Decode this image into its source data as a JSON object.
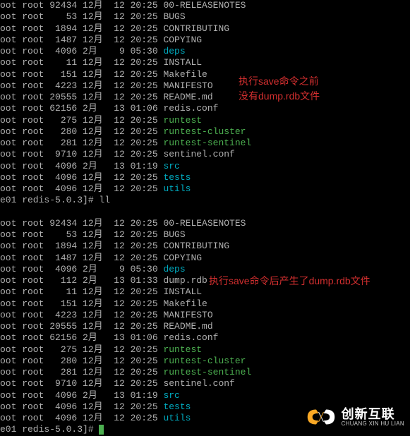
{
  "listing1": [
    {
      "perm": "oot root 92434 12月  12 20:25",
      "name": "00-RELEASENOTES",
      "color": "gray"
    },
    {
      "perm": "oot root    53 12月  12 20:25",
      "name": "BUGS",
      "color": "gray"
    },
    {
      "perm": "oot root  1894 12月  12 20:25",
      "name": "CONTRIBUTING",
      "color": "gray"
    },
    {
      "perm": "oot root  1487 12月  12 20:25",
      "name": "COPYING",
      "color": "gray"
    },
    {
      "perm": "oot root  4096 2月    9 05:30",
      "name": "deps",
      "color": "cyan"
    },
    {
      "perm": "oot root    11 12月  12 20:25",
      "name": "INSTALL",
      "color": "gray"
    },
    {
      "perm": "oot root   151 12月  12 20:25",
      "name": "Makefile",
      "color": "gray"
    },
    {
      "perm": "oot root  4223 12月  12 20:25",
      "name": "MANIFESTO",
      "color": "gray"
    },
    {
      "perm": "oot root 20555 12月  12 20:25",
      "name": "README.md",
      "color": "gray"
    },
    {
      "perm": "oot root 62156 2月   13 01:06",
      "name": "redis.conf",
      "color": "gray"
    },
    {
      "perm": "oot root   275 12月  12 20:25",
      "name": "runtest",
      "color": "green"
    },
    {
      "perm": "oot root   280 12月  12 20:25",
      "name": "runtest-cluster",
      "color": "green"
    },
    {
      "perm": "oot root   281 12月  12 20:25",
      "name": "runtest-sentinel",
      "color": "green"
    },
    {
      "perm": "oot root  9710 12月  12 20:25",
      "name": "sentinel.conf",
      "color": "gray"
    },
    {
      "perm": "oot root  4096 2月   13 01:19",
      "name": "src",
      "color": "cyan"
    },
    {
      "perm": "oot root  4096 12月  12 20:25",
      "name": "tests",
      "color": "cyan"
    },
    {
      "perm": "oot root  4096 12月  12 20:25",
      "name": "utils",
      "color": "cyan"
    }
  ],
  "prompt1": "e01 redis-5.0.3]# ll",
  "listing2": [
    {
      "perm": "oot root 92434 12月  12 20:25",
      "name": "00-RELEASENOTES",
      "color": "gray"
    },
    {
      "perm": "oot root    53 12月  12 20:25",
      "name": "BUGS",
      "color": "gray"
    },
    {
      "perm": "oot root  1894 12月  12 20:25",
      "name": "CONTRIBUTING",
      "color": "gray"
    },
    {
      "perm": "oot root  1487 12月  12 20:25",
      "name": "COPYING",
      "color": "gray"
    },
    {
      "perm": "oot root  4096 2月    9 05:30",
      "name": "deps",
      "color": "cyan"
    },
    {
      "perm": "oot root   112 2月   13 01:33",
      "name": "dump.rdb",
      "color": "gray"
    },
    {
      "perm": "oot root    11 12月  12 20:25",
      "name": "INSTALL",
      "color": "gray"
    },
    {
      "perm": "oot root   151 12月  12 20:25",
      "name": "Makefile",
      "color": "gray"
    },
    {
      "perm": "oot root  4223 12月  12 20:25",
      "name": "MANIFESTO",
      "color": "gray"
    },
    {
      "perm": "oot root 20555 12月  12 20:25",
      "name": "README.md",
      "color": "gray"
    },
    {
      "perm": "oot root 62156 2月   13 01:06",
      "name": "redis.conf",
      "color": "gray"
    },
    {
      "perm": "oot root   275 12月  12 20:25",
      "name": "runtest",
      "color": "green"
    },
    {
      "perm": "oot root   280 12月  12 20:25",
      "name": "runtest-cluster",
      "color": "green"
    },
    {
      "perm": "oot root   281 12月  12 20:25",
      "name": "runtest-sentinel",
      "color": "green"
    },
    {
      "perm": "oot root  9710 12月  12 20:25",
      "name": "sentinel.conf",
      "color": "gray"
    },
    {
      "perm": "oot root  4096 2月   13 01:19",
      "name": "src",
      "color": "cyan"
    },
    {
      "perm": "oot root  4096 12月  12 20:25",
      "name": "tests",
      "color": "cyan"
    },
    {
      "perm": "oot root  4096 12月  12 20:25",
      "name": "utils",
      "color": "cyan"
    }
  ],
  "prompt2": "e01 redis-5.0.3]# ",
  "annotation1_line1": "执行save命令之前",
  "annotation1_line2": "没有dump.rdb文件",
  "annotation2": "执行save命令后产生了dump.rdb文件",
  "logo_cn": "创新互联",
  "logo_en": "CHUANG XIN HU LIAN"
}
